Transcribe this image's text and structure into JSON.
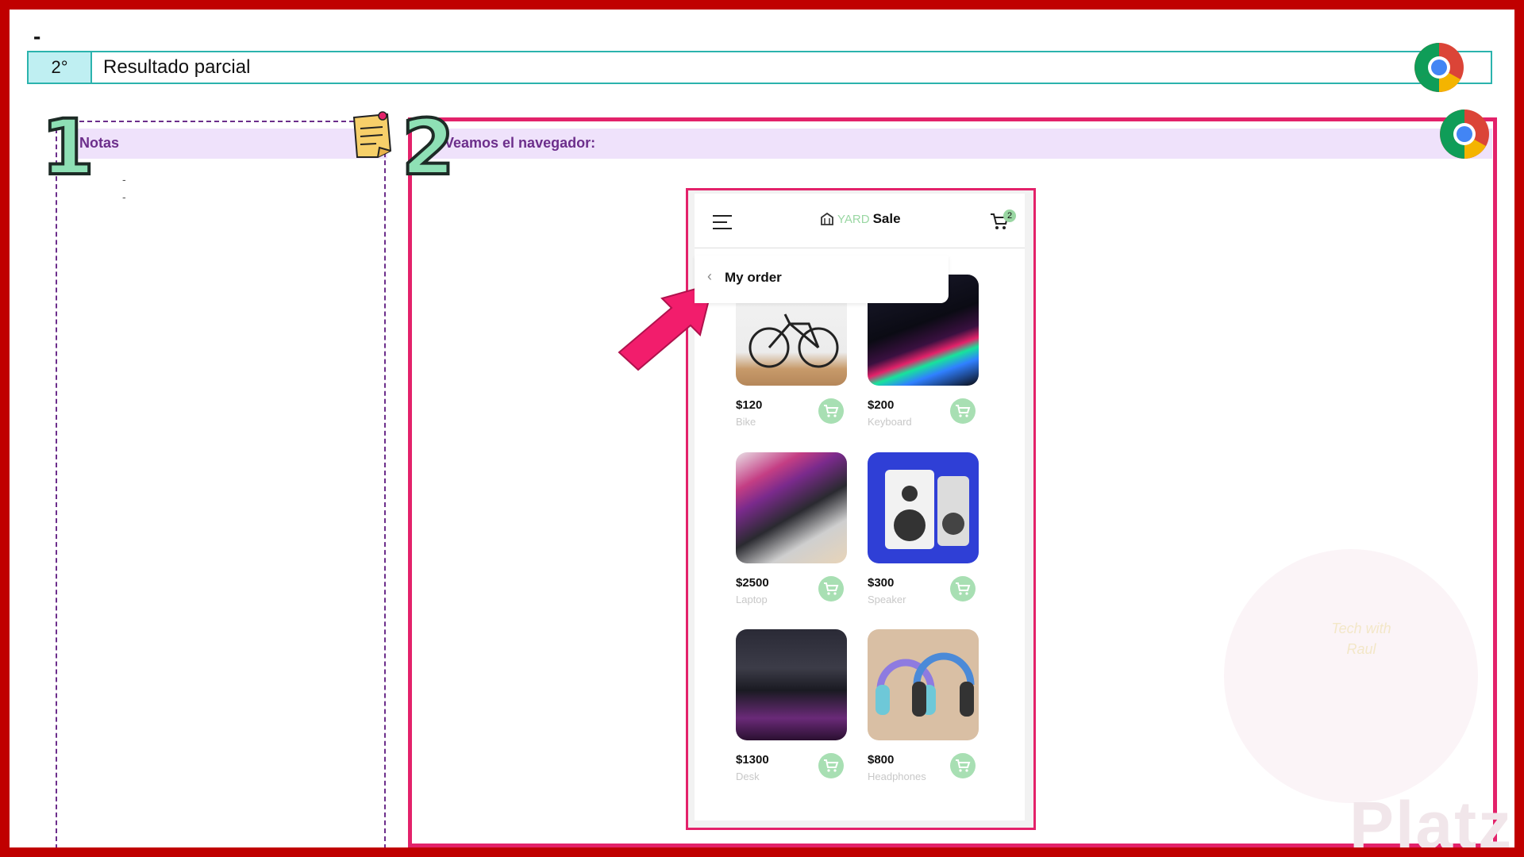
{
  "slide": {
    "dash": "-",
    "step_number": "2°",
    "step_title": "Resultado parcial"
  },
  "notes": {
    "number": "1",
    "label": "Notas",
    "bullets": [
      "-",
      "-"
    ]
  },
  "browser": {
    "number": "2",
    "label": "Veamos el navegador:"
  },
  "app": {
    "logo_yard": "YARD",
    "logo_sale": "Sale",
    "cart_count": "2",
    "order_title": "My order",
    "products": [
      {
        "price": "$120",
        "name": "Bike"
      },
      {
        "price": "$200",
        "name": "Keyboard"
      },
      {
        "price": "$2500",
        "name": "Laptop"
      },
      {
        "price": "$300",
        "name": "Speaker"
      },
      {
        "price": "$1300",
        "name": "Desk"
      },
      {
        "price": "$800",
        "name": "Headphones"
      }
    ]
  },
  "watermark": {
    "brand": "Platzi",
    "badge_line1": "Tech with",
    "badge_line2": "Raul"
  },
  "colors": {
    "frame": "#c00000",
    "accent_pink": "#e3226a",
    "teal": "#2bb3ad",
    "lavender": "#efe2fb",
    "purple_text": "#6c2e8b",
    "green": "#a8dfb3"
  }
}
